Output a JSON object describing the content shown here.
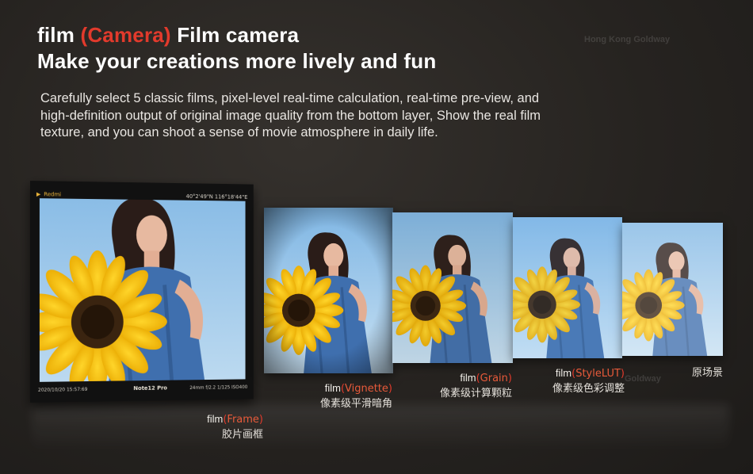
{
  "header": {
    "line1_prefix": "film",
    "line1_bracket_open": "(",
    "line1_accent": "Camera",
    "line1_bracket_close": ")",
    "line1_suffix": "Film camera",
    "line2": "Make your creations more lively and fun"
  },
  "description": "Carefully select 5 classic films, pixel-level real-time calculation, real-time pre-view, and high-definition output of original image quality from the bottom layer, Show the real film texture, and you can shoot a sense of movie atmosphere in daily life.",
  "watermark": "Hong Kong Goldway",
  "watermark2": "Goldway",
  "camera": {
    "brand": "Redmi",
    "coords": "40°2'49\"N 116°18'44\"E",
    "datetime": "2020/10/20  15:57:69",
    "model": "Note12 Pro",
    "specs": "24mm  f/2.2  1/125  ISO400"
  },
  "films": [
    {
      "prefix": "film",
      "open": "(",
      "name": "Frame",
      "close": ")",
      "cn": "胶片画框"
    },
    {
      "prefix": "film",
      "open": "(",
      "name": "Vignette",
      "close": ")",
      "cn": "像素级平滑暗角"
    },
    {
      "prefix": "film",
      "open": "(",
      "name": "Grain",
      "close": ")",
      "cn": "像素级计算颗粒"
    },
    {
      "prefix": "film",
      "open": "(",
      "name": "StyleLUT",
      "close": ")",
      "cn": "像素级色彩调整"
    }
  ],
  "original_label": "原场景",
  "colors": {
    "accent": "#e23a2c",
    "sky": "#8fc2ea",
    "sunflower": "#f6c21a",
    "dress": "#3f6fae"
  }
}
